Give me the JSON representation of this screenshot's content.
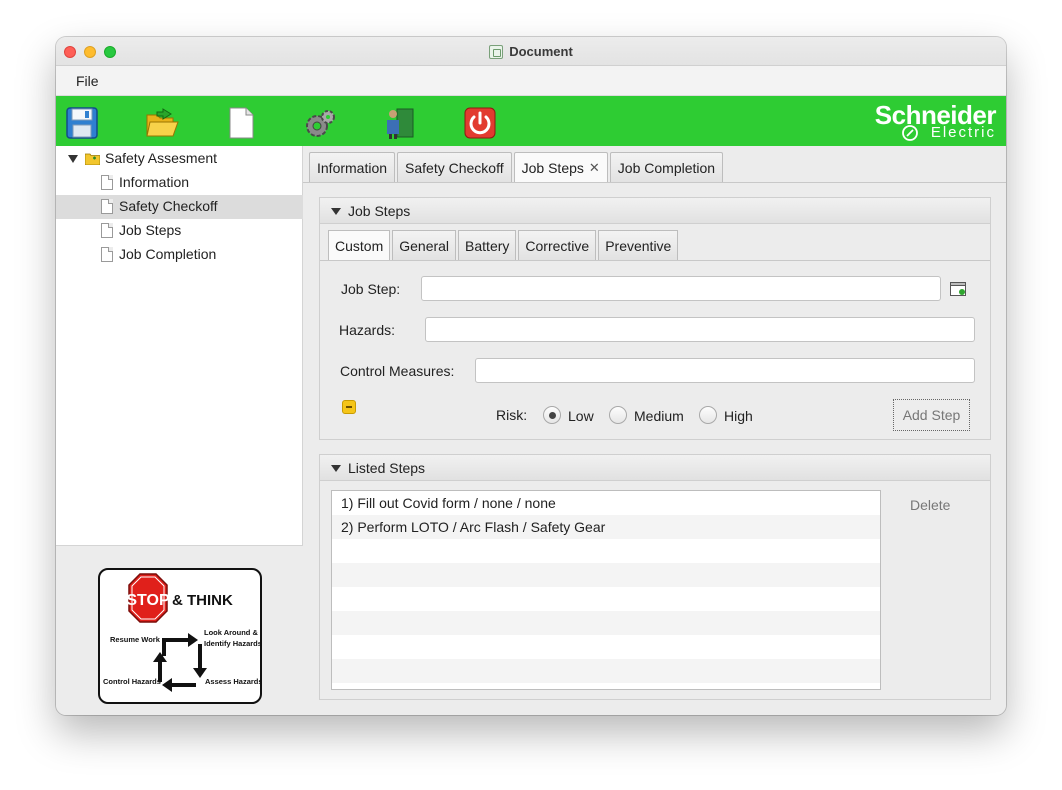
{
  "window": {
    "title": "Document"
  },
  "menu": {
    "file": "File"
  },
  "toolbar": {
    "buttons": [
      {
        "name": "save",
        "icon": "floppy-disk-icon"
      },
      {
        "name": "open",
        "icon": "folder-open-icon"
      },
      {
        "name": "new",
        "icon": "new-document-icon"
      },
      {
        "name": "settings",
        "icon": "gear-icon"
      },
      {
        "name": "exit-door",
        "icon": "door-icon"
      },
      {
        "name": "power",
        "icon": "power-icon"
      }
    ],
    "brand_name": "Schneider",
    "brand_sub": "Electric",
    "color": "#2ecc33"
  },
  "tree": {
    "root": "Safety Assesment",
    "items": [
      "Information",
      "Safety Checkoff",
      "Job Steps",
      "Job Completion"
    ],
    "selected": "Safety Checkoff"
  },
  "stop_card": {
    "stop": "STOP",
    "think": "& THINK",
    "resume": "Resume Work",
    "look1": "Look Around &",
    "look2": "Identify Hazards",
    "control": "Control Hazards",
    "assess": "Assess Hazards"
  },
  "main_tabs": [
    "Information",
    "Safety Checkoff",
    "Job Steps",
    "Job Completion"
  ],
  "active_main_tab": "Job Steps",
  "tab_close_glyph": "✕",
  "job_steps": {
    "title": "Job Steps",
    "sub_tabs": [
      "Custom",
      "General",
      "Battery",
      "Corrective",
      "Preventive"
    ],
    "active_sub_tab": "Custom",
    "job_step_label": "Job Step:",
    "job_step_value": "",
    "hazards_label": "Hazards:",
    "hazards_value": "",
    "control_label": "Control Measures:",
    "control_value": "",
    "risk_label": "Risk:",
    "risk_options": [
      "Low",
      "Medium",
      "High"
    ],
    "risk_selected": "Low",
    "add_step": "Add Step"
  },
  "listed_steps": {
    "title": "Listed Steps",
    "items": [
      "1) Fill out Covid form / none / none",
      "2) Perform LOTO / Arc Flash / Safety Gear"
    ],
    "delete": "Delete"
  }
}
